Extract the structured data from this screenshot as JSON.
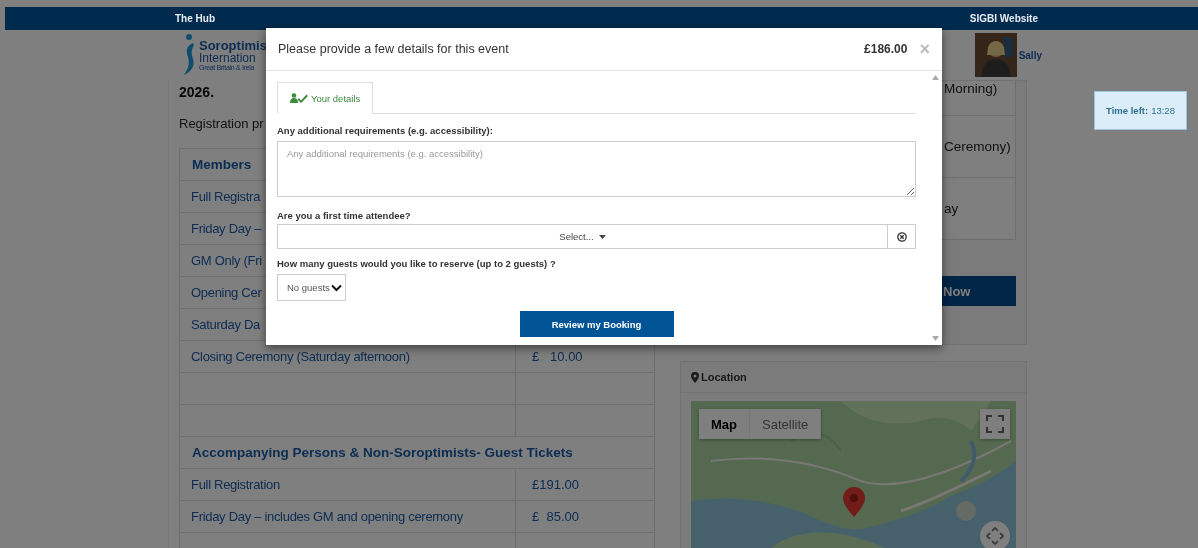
{
  "top_bar": {
    "left_link": "The Hub",
    "right_link": "SIGBI Website"
  },
  "header": {
    "logo": {
      "name": "Soroptimis",
      "line2": "Internation",
      "line3": "Great Britain & Irela"
    },
    "user": {
      "name": "Sally"
    }
  },
  "main": {
    "year": "2026.",
    "intro": "Registration pr",
    "price_rows": [
      {
        "kind": "heading",
        "label": "Members"
      },
      {
        "kind": "item",
        "label": "Full Registra"
      },
      {
        "kind": "item",
        "label": "Friday Day –"
      },
      {
        "kind": "item",
        "label": "GM Only (Fri"
      },
      {
        "kind": "item",
        "label": "Opening Cer"
      },
      {
        "kind": "item",
        "label": "Saturday Da"
      },
      {
        "kind": "item",
        "label": "Closing Ceremony (Saturday afternoon)",
        "price": "£   10.00"
      },
      {
        "kind": "blank"
      },
      {
        "kind": "blank"
      },
      {
        "kind": "heading",
        "label": "Accompanying Persons & Non-Soroptimists- Guest Tickets"
      },
      {
        "kind": "item",
        "label": "Full Registration",
        "price": "£191.00"
      },
      {
        "kind": "item",
        "label": "Friday Day – includes GM and opening ceremony",
        "price": "£  85.00"
      },
      {
        "kind": "blank"
      }
    ]
  },
  "side_panel": {
    "sessions": [
      "Morning)",
      "Ceremony)",
      "ay"
    ],
    "book_button": "Now",
    "location": {
      "title": "Location",
      "map": {
        "kind": "picture",
        "map_types": [
          {
            "label": "Map",
            "selected": true
          },
          {
            "label": "Satellite",
            "selected": false
          }
        ]
      }
    }
  },
  "timer": {
    "label": "Time left:",
    "value": "13:28"
  },
  "modal": {
    "title": "Please provide a few details for this event",
    "total": "£186.00",
    "close": "×",
    "tabs": [
      {
        "label": "Your details",
        "selected": true
      }
    ],
    "fields": [
      {
        "kind": "textarea",
        "label": "Any additional requirements (e.g. accessibility):",
        "placeholder": "Any additional requirements (e.g. accessibility)"
      },
      {
        "kind": "select",
        "label": "Are you a first time attendee?",
        "value": "Select..."
      },
      {
        "kind": "dropdown",
        "label": "How many guests would you like to reserve (up to 2 guests) ?",
        "value": "No guests"
      }
    ],
    "submit": "Review my Booking"
  }
}
